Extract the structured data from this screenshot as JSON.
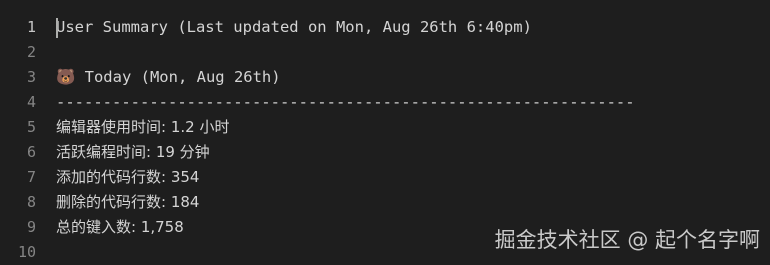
{
  "editor": {
    "line_numbers": [
      "1",
      "2",
      "3",
      "4",
      "5",
      "6",
      "7",
      "8",
      "9",
      "10"
    ],
    "lines": [
      "User Summary (Last updated on Mon, Aug 26th 6:40pm)",
      "",
      "🐻 Today (Mon, Aug 26th)",
      "--------------------------------------------------------------",
      "编辑器使用时间: 1.2 小时",
      "活跃编程时间: 19 分钟",
      "添加的代码行数: 354",
      "删除的代码行数: 184",
      "总的键入数: 1,758",
      ""
    ]
  },
  "watermark": {
    "text": "掘金技术社区 @ 起个名字啊"
  },
  "colors": {
    "background": "#1e1e1e",
    "text": "#d4d4d4",
    "line_number": "#858585",
    "line_number_active": "#c6c6c6"
  }
}
